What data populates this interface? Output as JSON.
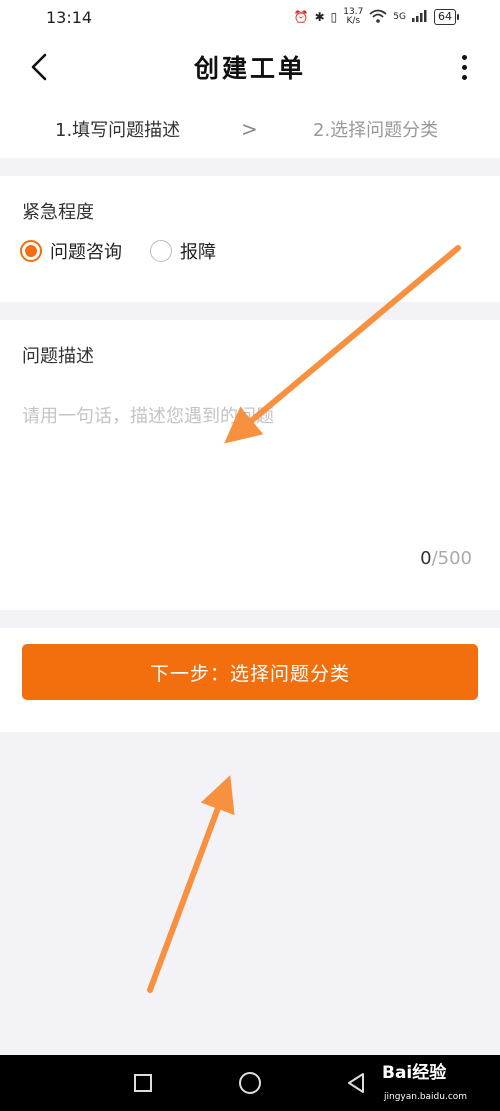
{
  "status_bar": {
    "time": "13:14",
    "net_speed_value": "13.7",
    "net_speed_unit": "K/s",
    "network": "5G",
    "battery": "64"
  },
  "header": {
    "title": "创建工单",
    "back_icon": "chevron-left-icon",
    "more_icon": "more-vertical-icon"
  },
  "steps": {
    "step1_label": "1.填写问题描述",
    "separator": ">",
    "step2_label": "2.选择问题分类"
  },
  "urgency": {
    "label": "紧急程度",
    "options": [
      {
        "label": "问题咨询",
        "selected": true
      },
      {
        "label": "报障",
        "selected": false
      }
    ],
    "accent_color": "#f36e12"
  },
  "description": {
    "label": "问题描述",
    "value": "",
    "placeholder": "请用一句话，描述您遇到的问题",
    "count_current": "0",
    "count_separator": "/",
    "count_max": "500"
  },
  "action": {
    "next_label": "下一步：选择问题分类",
    "button_color": "#f36e0c"
  },
  "annotation": {
    "arrow_color": "#f7913f"
  },
  "system_nav": {
    "recent_icon": "square-icon",
    "home_icon": "circle-icon",
    "back_icon": "triangle-back-icon"
  },
  "watermark": {
    "brand": "Bai经验",
    "url": "jingyan.baidu.com"
  }
}
